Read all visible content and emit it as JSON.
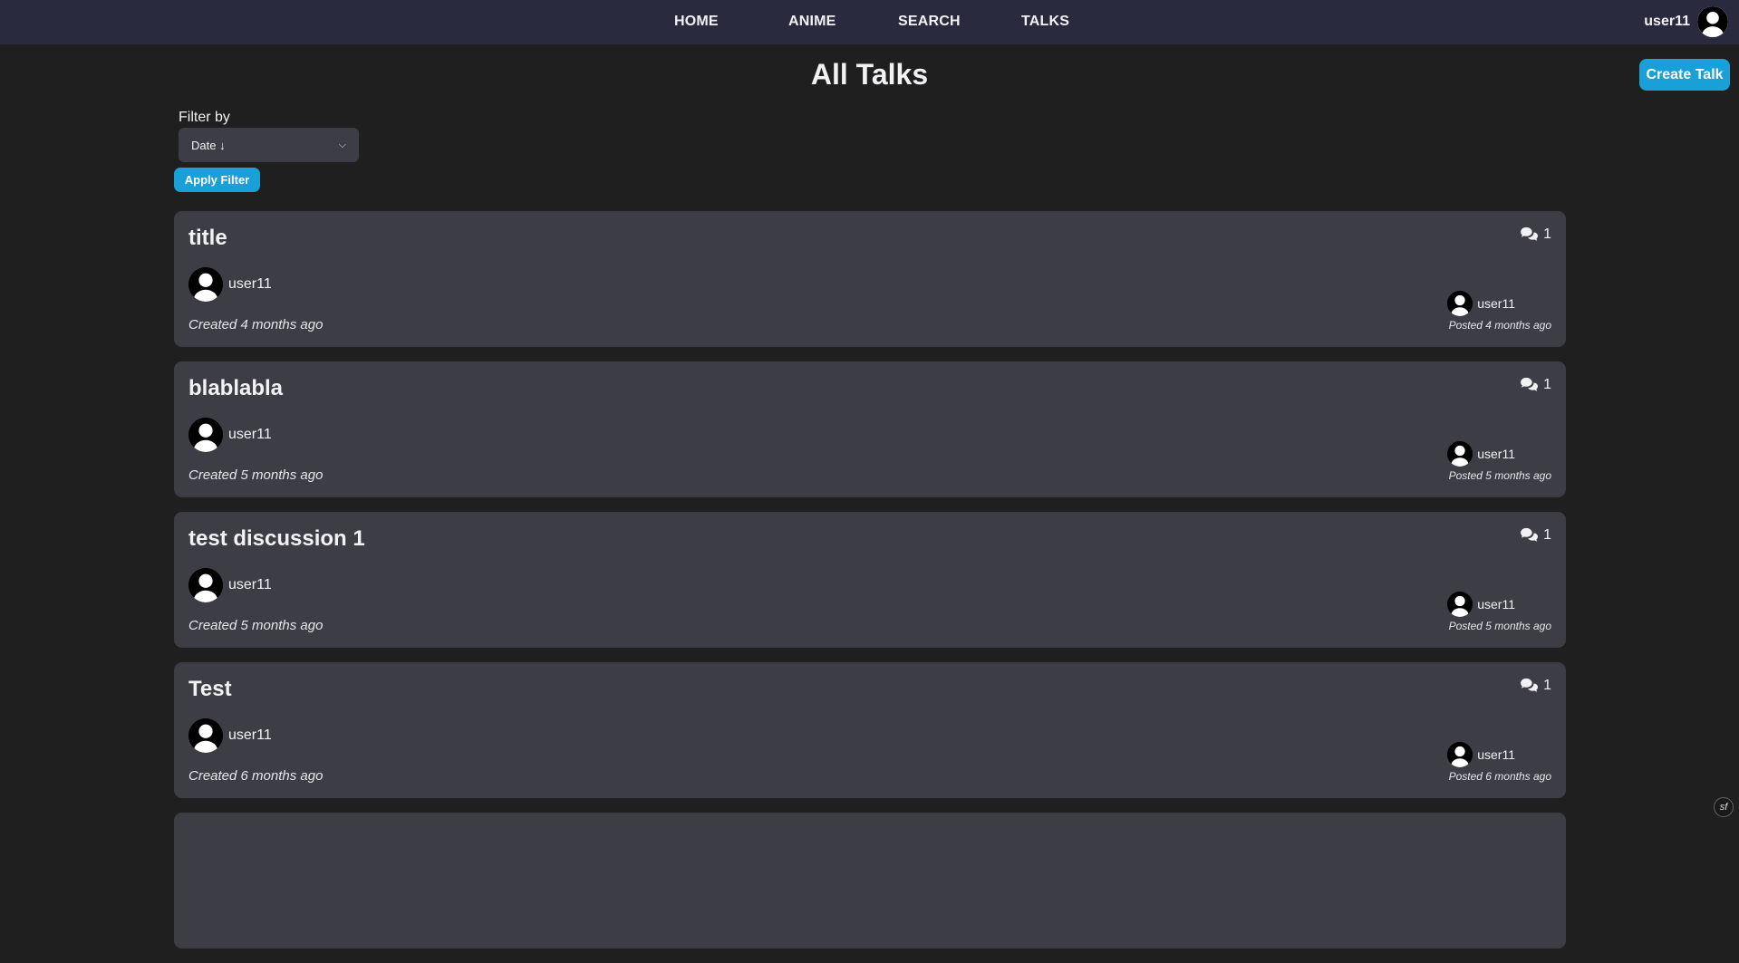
{
  "nav": {
    "links": [
      {
        "label": "HOME"
      },
      {
        "label": "ANIME"
      },
      {
        "label": "SEARCH"
      },
      {
        "label": "TALKS"
      }
    ],
    "username": "user11"
  },
  "page": {
    "title": "All Talks",
    "create_label": "Create Talk"
  },
  "filter": {
    "label": "Filter by",
    "selected": "Date ↓",
    "apply_label": "Apply Filter"
  },
  "talks": [
    {
      "title": "title",
      "author": "user11",
      "created": "Created 4 months ago",
      "replies": "1",
      "last_user": "user11",
      "posted": "Posted 4 months ago"
    },
    {
      "title": "blablabla",
      "author": "user11",
      "created": "Created 5 months ago",
      "replies": "1",
      "last_user": "user11",
      "posted": "Posted 5 months ago"
    },
    {
      "title": "test discussion 1",
      "author": "user11",
      "created": "Created 5 months ago",
      "replies": "1",
      "last_user": "user11",
      "posted": "Posted 5 months ago"
    },
    {
      "title": "Test",
      "author": "user11",
      "created": "Created 6 months ago",
      "replies": "1",
      "last_user": "user11",
      "posted": "Posted 6 months ago"
    },
    {
      "title": "",
      "author": "",
      "created": "",
      "replies": "",
      "last_user": "",
      "posted": ""
    }
  ],
  "icons": {
    "avatar": "user-avatar-icon",
    "replies": "comments-icon",
    "debug": "symfony-icon"
  },
  "colors": {
    "background": "#1f1f1f",
    "navbar": "#2a2a3e",
    "card": "#3d3d45",
    "accent": "#1aa0d8"
  }
}
